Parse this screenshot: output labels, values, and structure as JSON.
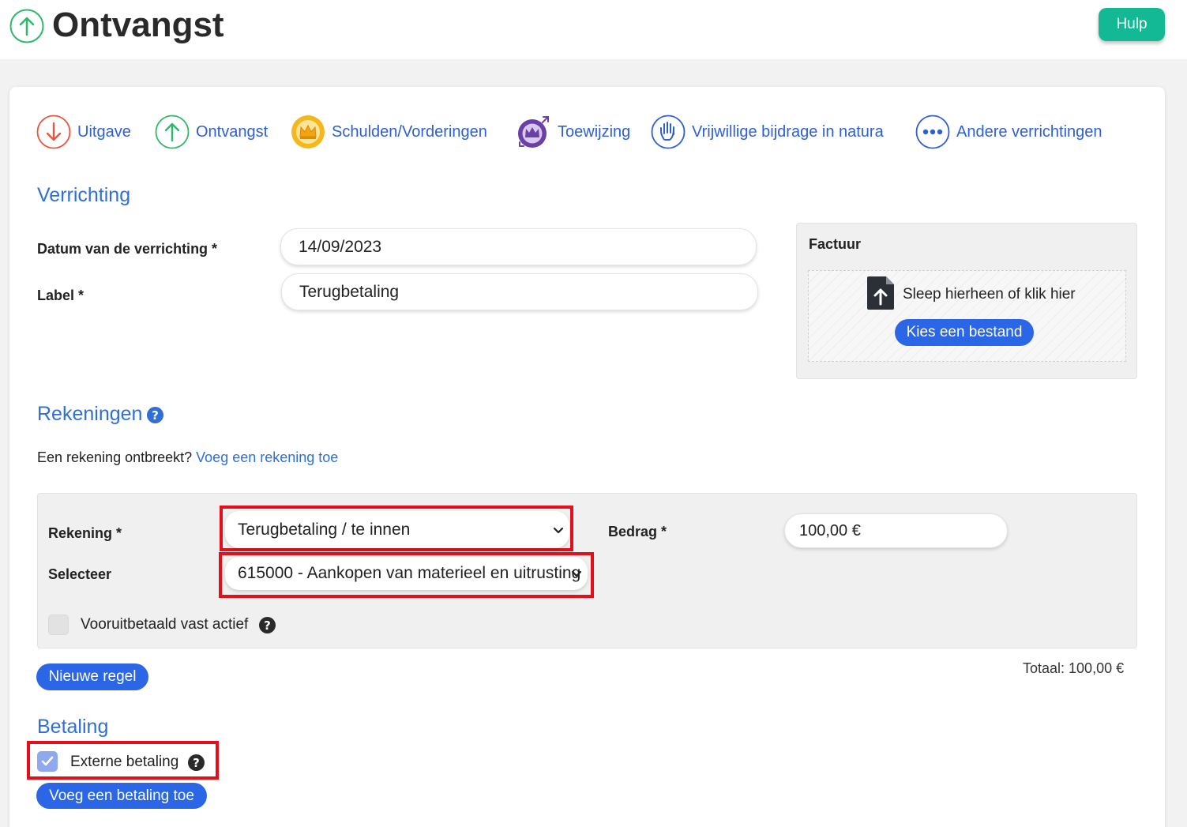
{
  "header": {
    "title": "Ontvangst",
    "help_label": "Hulp"
  },
  "tabs": [
    {
      "label": "Uitgave",
      "icon": "arrow-down-icon",
      "color": "#e8553c"
    },
    {
      "label": "Ontvangst",
      "icon": "arrow-up-icon",
      "color": "#2eb86a"
    },
    {
      "label": "Schulden/Vorderingen",
      "icon": "crown-icon",
      "color": "#f2b21a"
    },
    {
      "label": "Toewijzing",
      "icon": "crown-arrows-icon",
      "color": "#6b3fa8"
    },
    {
      "label": "Vrijwillige bijdrage in natura",
      "icon": "hand-icon",
      "color": "#2f5fd4"
    },
    {
      "label": "Andere verrichtingen",
      "icon": "more-icon",
      "color": "#2f5fd4"
    }
  ],
  "operation": {
    "section_title": "Verrichting",
    "date_label": "Datum van de verrichting *",
    "date_value": "14/09/2023",
    "label_label": "Label *",
    "label_value": "Terugbetaling"
  },
  "invoice": {
    "title": "Factuur",
    "drop_text": "Sleep hierheen of klik hier",
    "choose_label": "Kies een bestand"
  },
  "accounts": {
    "section_title": "Rekeningen",
    "missing_text": "Een rekening ontbreekt?",
    "add_link": "Voeg een rekening toe",
    "account_label": "Rekening *",
    "account_value": "Terugbetaling / te innen",
    "select_label": "Selecteer",
    "select_value": "615000 - Aankopen van materieel en uitrusting",
    "amount_label": "Bedrag *",
    "amount_value": "100,00 €",
    "prepaid_label": "Vooruitbetaald vast actief",
    "new_line_label": "Nieuwe regel",
    "total": "Totaal: 100,00 €"
  },
  "payment": {
    "section_title": "Betaling",
    "external_label": "Externe betaling",
    "external_checked": true,
    "add_label": "Voeg een betaling toe"
  },
  "colors": {
    "accent": "#2f6fd6",
    "button": "#2a66e6",
    "help": "#13b994",
    "highlight": "#e3101b"
  }
}
